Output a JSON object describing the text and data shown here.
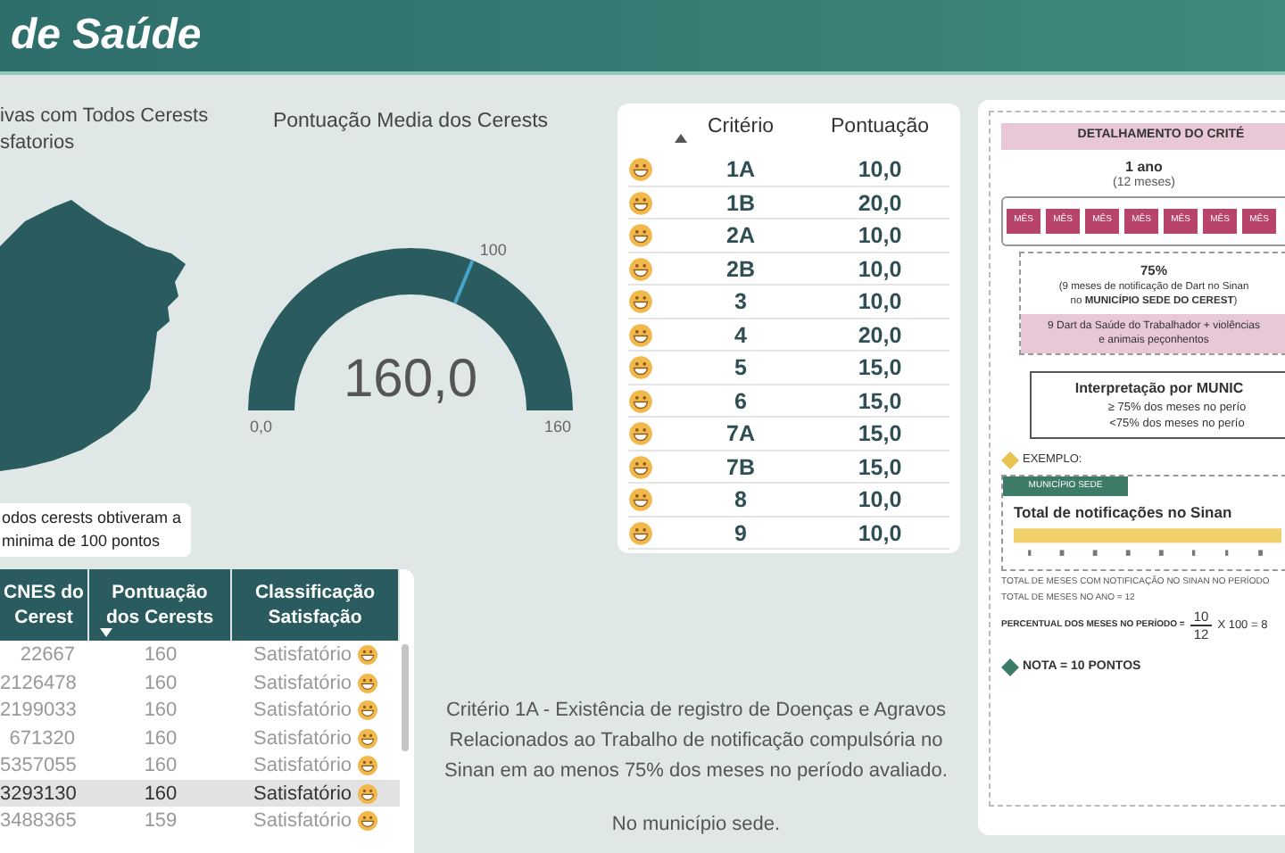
{
  "header": {
    "title": "de Saúde"
  },
  "map_card": {
    "title_lines": [
      "ivas com Todos Cerests",
      "sfatorios"
    ],
    "callout_lines": [
      "odos cerests obtiveram a",
      "minima de 100 pontos"
    ]
  },
  "gauge": {
    "title": "Pontuação Media dos Cerests",
    "value": "160,0",
    "target_label": "100",
    "min_label": "0,0",
    "max_label": "160"
  },
  "criteria_table": {
    "columns": [
      {
        "label": "Critério",
        "sorted": true
      },
      {
        "label": "Pontuação",
        "sorted": false
      }
    ],
    "rows": [
      {
        "criterion": "1A",
        "score": "10,0"
      },
      {
        "criterion": "1B",
        "score": "20,0"
      },
      {
        "criterion": "2A",
        "score": "10,0"
      },
      {
        "criterion": "2B",
        "score": "10,0"
      },
      {
        "criterion": "3",
        "score": "10,0"
      },
      {
        "criterion": "4",
        "score": "20,0"
      },
      {
        "criterion": "5",
        "score": "15,0"
      },
      {
        "criterion": "6",
        "score": "15,0"
      },
      {
        "criterion": "7A",
        "score": "15,0"
      },
      {
        "criterion": "7B",
        "score": "15,0"
      },
      {
        "criterion": "8",
        "score": "10,0"
      },
      {
        "criterion": "9",
        "score": "10,0"
      }
    ]
  },
  "cerest_table": {
    "columns": [
      {
        "label": "CNES do Cerest",
        "sorted": false
      },
      {
        "label": "Pontuação dos Cerests",
        "sorted": true
      },
      {
        "label": "Classificação Satisfação",
        "sorted": false
      }
    ],
    "rows": [
      {
        "cnes": "22667",
        "score": "160",
        "class": "Satisfatório",
        "selected": false
      },
      {
        "cnes": "2126478",
        "score": "160",
        "class": "Satisfatório",
        "selected": false
      },
      {
        "cnes": "2199033",
        "score": "160",
        "class": "Satisfatório",
        "selected": false
      },
      {
        "cnes": "671320",
        "score": "160",
        "class": "Satisfatório",
        "selected": false
      },
      {
        "cnes": "5357055",
        "score": "160",
        "class": "Satisfatório",
        "selected": false
      },
      {
        "cnes": "3293130",
        "score": "160",
        "class": "Satisfatório",
        "selected": true
      },
      {
        "cnes": "3488365",
        "score": "159",
        "class": "Satisfatório",
        "selected": false
      }
    ]
  },
  "description": {
    "paragraph": "Critério 1A - Existência de registro de Doenças e Agravos Relacionados ao Trabalho de notificação compulsória no Sinan em ao menos 75% dos meses no período avaliado.",
    "note": "No município sede."
  },
  "infographic": {
    "banner": "DETALHAMENTO DO CRITÉ",
    "year": "1 ano",
    "year_sub": "(12 meses)",
    "month_cells": [
      "MÊS",
      "MÊS",
      "MÊS",
      "MÊS",
      "MÊS",
      "MÊS",
      "MÊS"
    ],
    "percent": "75%",
    "percent_lines": [
      "(9 meses de notificação de Dart no Sinan",
      "no **MUNICÍPIO SEDE DO CEREST**)"
    ],
    "dart_note": "9 Dart da Saúde do Trabalhador + violências e animais peçonhentos",
    "interpretation_title": "Interpretação por MUNIC",
    "interpretation_lines": [
      "≥ 75% dos meses no perío",
      "<75% dos meses no perío"
    ],
    "example_label": "EXEMPLO:",
    "example_tab": "MUNICÍPIO SEDE",
    "example_title": "Total de notificações no Sinan",
    "formula_lines": [
      "TOTAL DE MESES COM NOTIFICAÇÃO NO SINAN NO PERÍODO",
      "TOTAL DE MESES NO ANO = 12"
    ],
    "formula_label": "PERCENTUAL DOS MESES NO PERÍODO =",
    "numerator": "10",
    "denominator": "12",
    "formula_rest": "X 100 = 8",
    "grade": "NOTA = 10 PONTOS"
  }
}
